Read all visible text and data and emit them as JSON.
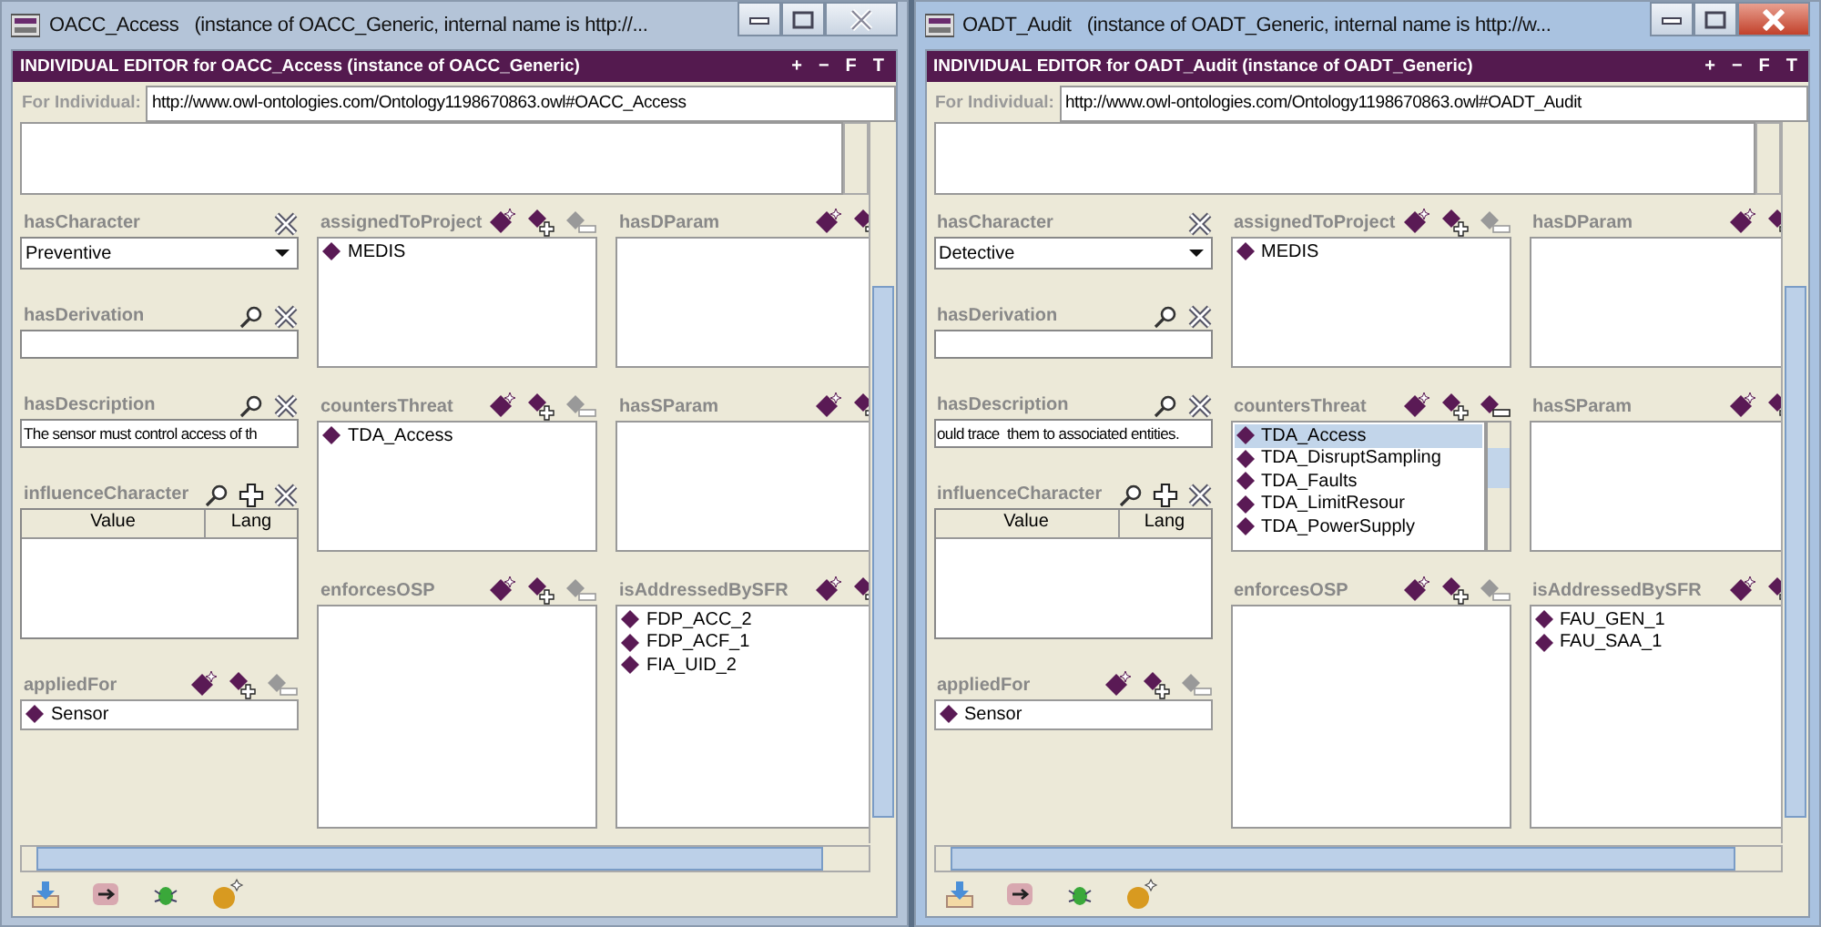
{
  "windows": [
    {
      "title": "OACC_Access   (instance of OACC_Generic, internal name is http://...",
      "active": false,
      "editor_title": "INDIVIDUAL EDITOR for OACC_Access   (instance of OACC_Generic)",
      "header_buttons": [
        "+",
        "−",
        "F",
        "T"
      ],
      "for_individual": {
        "label": "For Individual:",
        "value": "http://www.owl-ontologies.com/Ontology1198670863.owl#OACC_Access"
      },
      "left": [
        {
          "kind": "select",
          "label": "hasCharacter",
          "value": "Preventive"
        },
        {
          "kind": "field",
          "label": "hasDerivation"
        },
        {
          "kind": "field",
          "label": "hasDescription",
          "value": "The sensor must control access of th"
        },
        {
          "kind": "table",
          "label": "influenceCharacter",
          "columns": [
            "Value",
            "Lang"
          ]
        },
        {
          "kind": "list",
          "label": "appliedFor",
          "remove_enabled": false,
          "items": [
            {
              "text": "Sensor",
              "selected": false
            }
          ]
        }
      ],
      "middle": [
        {
          "label": "assignedToProject",
          "remove_enabled": false,
          "items": [
            {
              "text": "MEDIS",
              "selected": false
            }
          ]
        },
        {
          "label": "countersThreat",
          "remove_enabled": false,
          "items": [
            {
              "text": "TDA_Access",
              "selected": false
            }
          ]
        },
        {
          "label": "enforcesOSP",
          "remove_enabled": false
        }
      ],
      "right": [
        {
          "label": "hasDParam"
        },
        {
          "label": "hasSParam"
        },
        {
          "label": "isAddressedBySFR",
          "items": [
            {
              "text": "FDP_ACC_2",
              "selected": false
            },
            {
              "text": "FDP_ACF_1",
              "selected": false
            },
            {
              "text": "FIA_UID_2",
              "selected": false
            }
          ]
        }
      ]
    },
    {
      "title": "OADT_Audit   (instance of OADT_Generic, internal name is http://w...",
      "active": true,
      "editor_title": "INDIVIDUAL EDITOR for OADT_Audit   (instance of OADT_Generic)",
      "header_buttons": [
        "+",
        "−",
        "F",
        "T"
      ],
      "for_individual": {
        "label": "For Individual:",
        "value": "http://www.owl-ontologies.com/Ontology1198670863.owl#OADT_Audit"
      },
      "left": [
        {
          "kind": "select",
          "label": "hasCharacter",
          "value": "Detective"
        },
        {
          "kind": "field",
          "label": "hasDerivation"
        },
        {
          "kind": "field",
          "label": "hasDescription",
          "value": "ould trace  them to associated entities."
        },
        {
          "kind": "table",
          "label": "influenceCharacter",
          "columns": [
            "Value",
            "Lang"
          ]
        },
        {
          "kind": "list",
          "label": "appliedFor",
          "remove_enabled": false,
          "items": [
            {
              "text": "Sensor",
              "selected": false
            }
          ]
        }
      ],
      "middle": [
        {
          "label": "assignedToProject",
          "remove_enabled": false,
          "items": [
            {
              "text": "MEDIS",
              "selected": false
            }
          ]
        },
        {
          "label": "countersThreat",
          "remove_enabled": true,
          "scrollable": true,
          "items": [
            {
              "text": "TDA_Access",
              "selected": true
            },
            {
              "text": "TDA_DisruptSampling",
              "selected": false
            },
            {
              "text": "TDA_Faults",
              "selected": false
            },
            {
              "text": "TDA_LimitResour",
              "selected": false
            },
            {
              "text": "TDA_PowerSupply",
              "selected": false
            }
          ]
        },
        {
          "label": "enforcesOSP",
          "remove_enabled": false
        }
      ],
      "right": [
        {
          "label": "hasDParam"
        },
        {
          "label": "hasSParam"
        },
        {
          "label": "isAddressedBySFR",
          "items": [
            {
              "text": "FAU_GEN_1",
              "selected": false
            },
            {
              "text": "FAU_SAA_1",
              "selected": false
            }
          ]
        }
      ]
    }
  ]
}
